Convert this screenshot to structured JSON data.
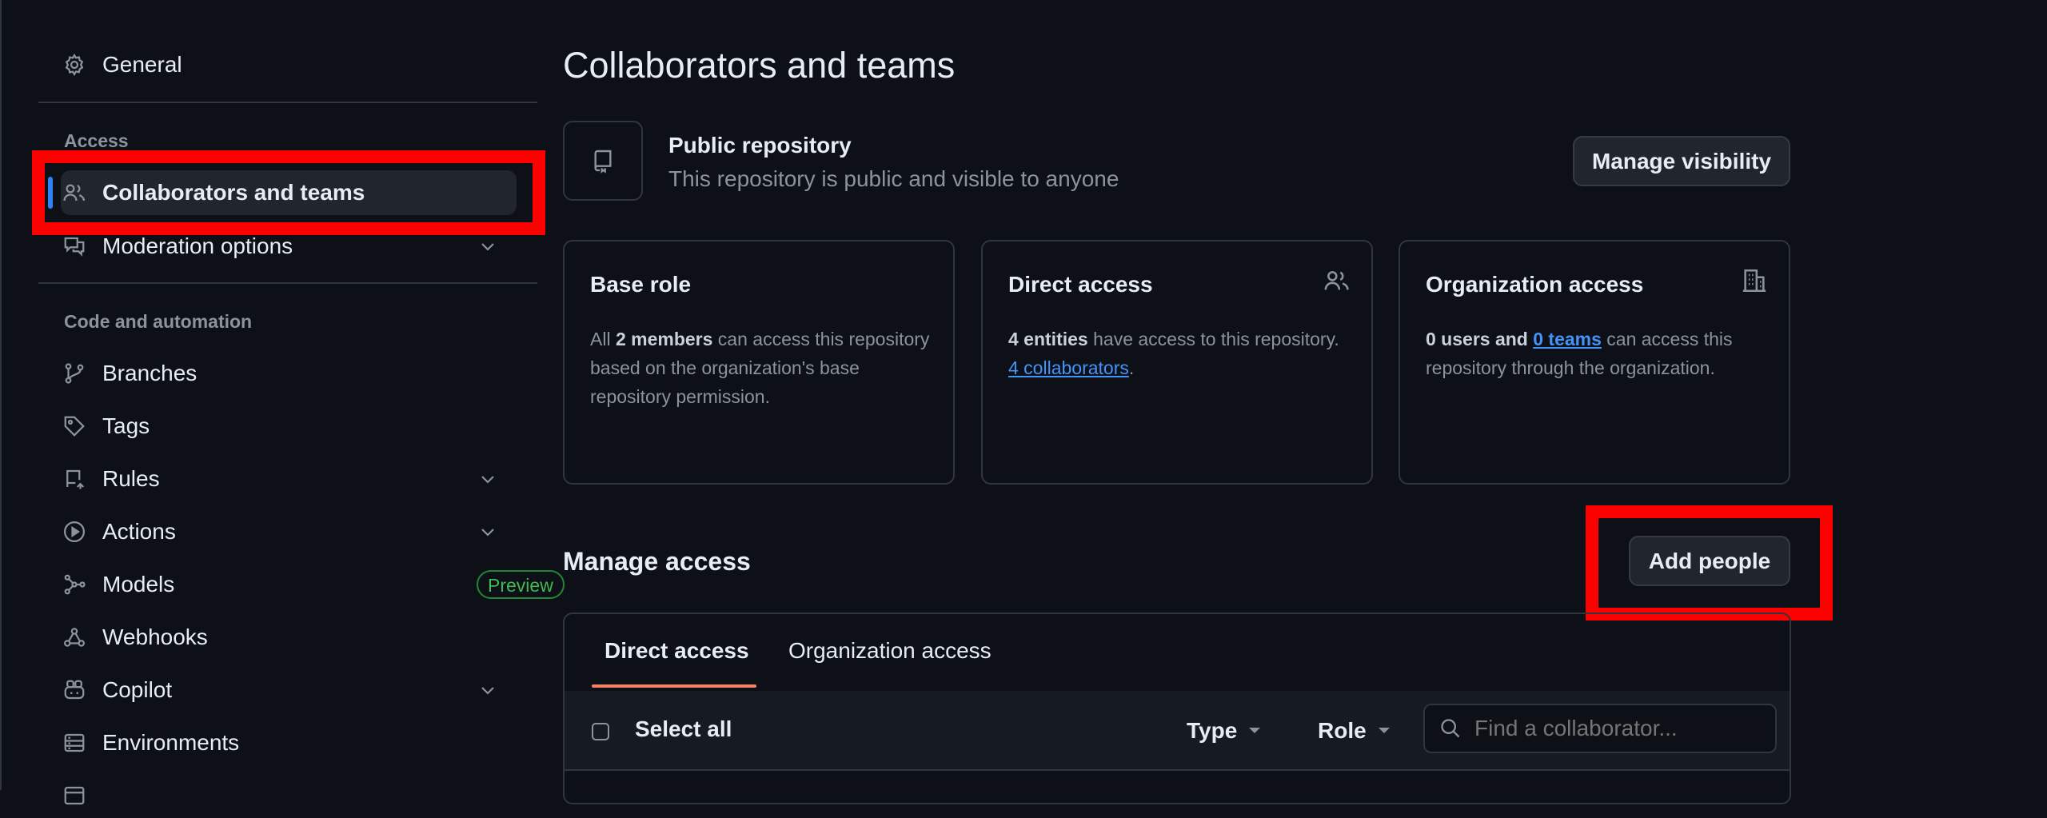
{
  "sidebar": {
    "general": "General",
    "access_heading": "Access",
    "collaborators": "Collaborators and teams",
    "moderation": "Moderation options",
    "code_heading": "Code and automation",
    "branches": "Branches",
    "tags": "Tags",
    "rules": "Rules",
    "actions": "Actions",
    "models": "Models",
    "preview_badge": "Preview",
    "webhooks": "Webhooks",
    "copilot": "Copilot",
    "environments": "Environments"
  },
  "main": {
    "page_title": "Collaborators and teams",
    "visibility_title": "Public repository",
    "visibility_desc": "This repository is public and visible to anyone",
    "manage_visibility": "Manage visibility",
    "base_role": {
      "title": "Base role",
      "all": "All ",
      "members": "2 members",
      "rest": " can access this repository based on the organization's base repository permission."
    },
    "direct_access": {
      "title": "Direct access",
      "entities": "4 entities",
      "rest": " have access to this repository. ",
      "link": "4 collaborators",
      "end": "."
    },
    "org_access": {
      "title": "Organization access",
      "users": "0 users and",
      "space": " ",
      "link": "0 teams",
      "rest": " can access this repository through the organization."
    },
    "manage_access": "Manage access",
    "add_people": "Add people",
    "tabs": [
      "Direct access",
      "Organization access"
    ],
    "select_all": "Select all",
    "type_filter": "Type",
    "role_filter": "Role",
    "search_placeholder": "Find a collaborator..."
  },
  "colors": {
    "background": "#0d1117",
    "accent_link": "#4493f8",
    "tab_underline": "#f78166",
    "highlight": "#ff0000",
    "preview_green": "#3fb950"
  }
}
